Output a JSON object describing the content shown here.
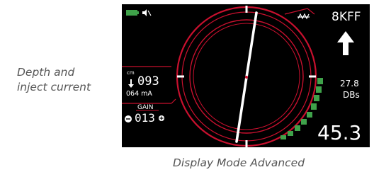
{
  "captions": {
    "side": "Depth and\ninject current",
    "bottom": "Display Mode Advanced"
  },
  "status": {
    "battery_icon": "battery-icon",
    "speaker_icon": "speaker-muted-icon",
    "signal_icon": "signal-icon"
  },
  "frequency": {
    "label": "8KFF"
  },
  "direction": {
    "icon": "up-arrow-icon"
  },
  "signal_strength": {
    "value": "27.8",
    "unit": "DBs"
  },
  "depth": {
    "unit": "cm",
    "value": "093",
    "current": "064 mA"
  },
  "gain": {
    "label": "GAIN",
    "value": "013",
    "decrease_icon": "minus-icon",
    "increase_icon": "plus-icon"
  },
  "readout": {
    "value": "45.3"
  },
  "colors": {
    "screen_bg": "#000000",
    "accent_red": "#c8102e",
    "green_bar": "#3fa24a",
    "needle": "#ffffff"
  }
}
